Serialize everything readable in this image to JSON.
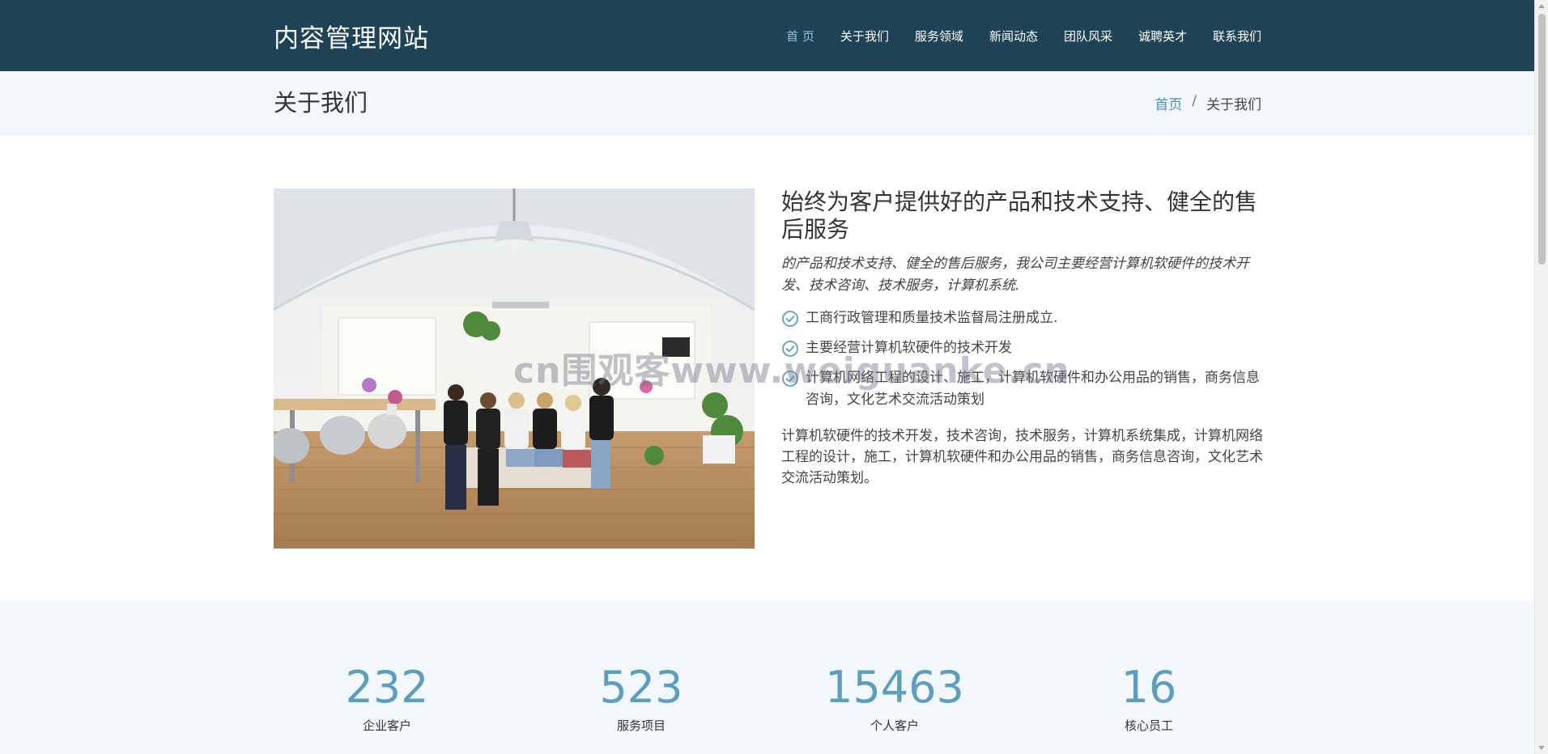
{
  "site": {
    "logo": "内容管理网站"
  },
  "nav": {
    "items": [
      {
        "label": "首 页",
        "active": true
      },
      {
        "label": "关于我们"
      },
      {
        "label": "服务领域"
      },
      {
        "label": "新闻动态"
      },
      {
        "label": "团队风采"
      },
      {
        "label": "诚聘英才"
      },
      {
        "label": "联系我们"
      }
    ]
  },
  "page": {
    "title": "关于我们",
    "breadcrumb": {
      "home": "首页",
      "separator": "/",
      "current": "关于我们"
    }
  },
  "about": {
    "heading": "始终为客户提供好的产品和技术支持、健全的售后服务",
    "lead": "的产品和技术支持、健全的售后服务，我公司主要经营计算机软硬件的技术开发、技术咨询、技术服务，计算机系统.",
    "bullets": [
      "工商行政管理和质量技术监督局注册成立.",
      "主要经营计算机软硬件的技术开发",
      "计算机网络工程的设计、施工，计算机软硬件和办公用品的销售，商务信息咨询，文化艺术交流活动策划"
    ],
    "paragraph": "计算机软硬件的技术开发，技术咨询，技术服务，计算机系统集成，计算机网络工程的设计，施工，计算机软硬件和办公用品的销售，商务信息咨询，文化艺术交流活动策划。"
  },
  "watermark": "cn围观客www.weiguanke.cn",
  "stats": [
    {
      "number": "232",
      "label": "企业客户"
    },
    {
      "number": "523",
      "label": "服务项目"
    },
    {
      "number": "15463",
      "label": "个人客户"
    },
    {
      "number": "16",
      "label": "核心员工"
    }
  ],
  "colors": {
    "header_bg": "#1e4356",
    "accent": "#5d9ebf",
    "light_bg": "#f1f7fa"
  }
}
